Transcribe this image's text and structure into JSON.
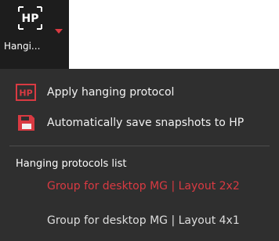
{
  "toolbar": {
    "label": "Hangi...",
    "icon": "hanging-protocol-icon",
    "caret_icon": "dropdown-caret-icon",
    "accent": "#d93a42"
  },
  "menu": {
    "apply_label": "Apply hanging protocol",
    "apply_icon": "hp-icon",
    "autosave_label": "Automatically save snapshots to HP",
    "autosave_icon": "save-icon",
    "section_title": "Hanging protocols list",
    "protocols": [
      {
        "label": "Group for desktop MG | Layout 2x2",
        "active": true
      },
      {
        "label": "Group for desktop MG | Layout 4x1",
        "active": false
      }
    ]
  },
  "colors": {
    "toolbar_bg": "#1d1d1d",
    "menu_bg": "#2f2f2f",
    "text": "#f2f2f2",
    "active": "#d93a42"
  }
}
